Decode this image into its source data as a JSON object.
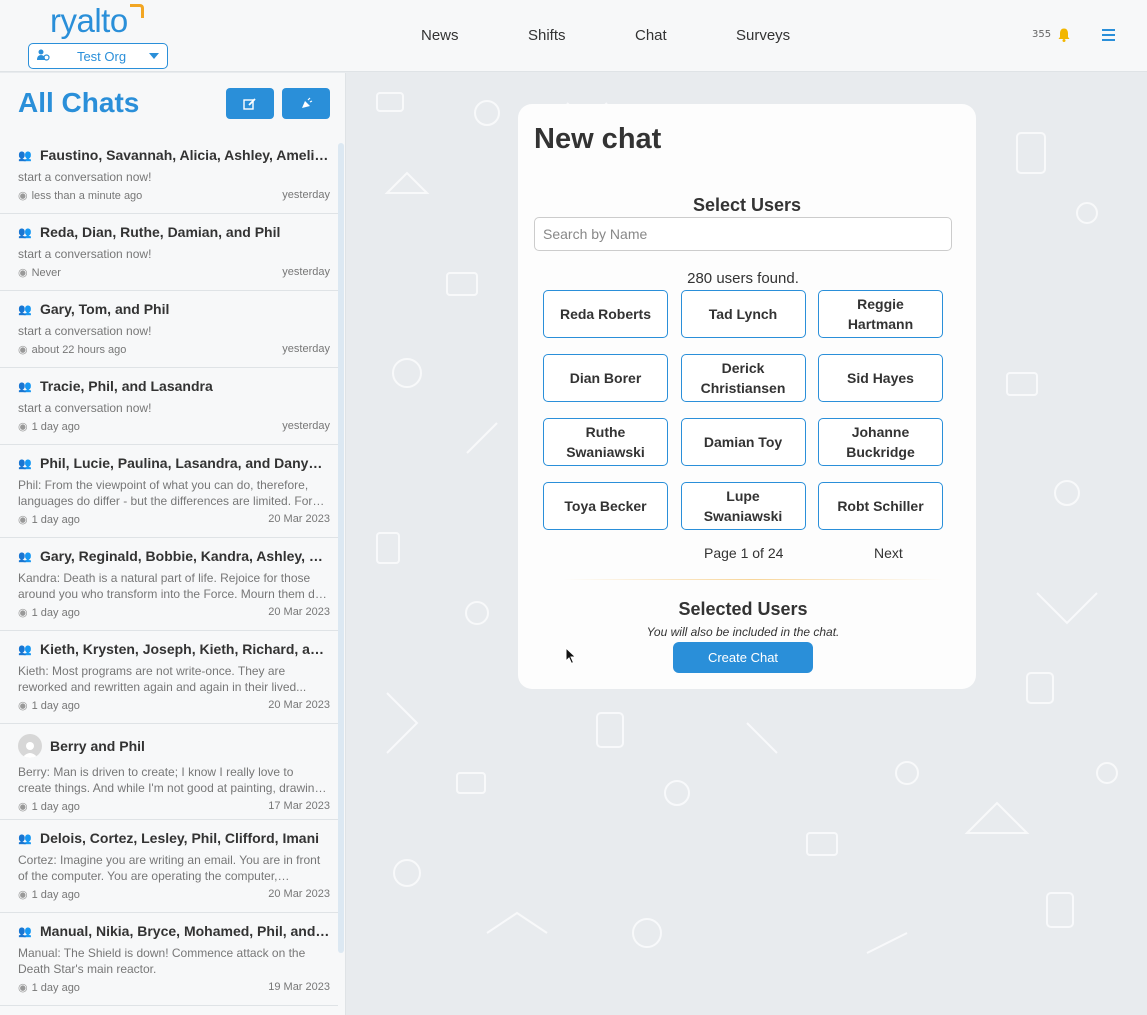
{
  "header": {
    "logo_text": "ryalto",
    "org_select": {
      "value": "Test Org",
      "icon": "org-user-icon"
    },
    "nav": [
      {
        "label": "News"
      },
      {
        "label": "Shifts"
      },
      {
        "label": "Chat"
      },
      {
        "label": "Surveys"
      }
    ],
    "notification_count": "355",
    "icons": [
      "bell-icon",
      "hamburger-menu-icon"
    ]
  },
  "sidebar": {
    "title": "All Chats",
    "buttons": [
      {
        "icon": "compose-icon"
      },
      {
        "icon": "broadcast-icon"
      }
    ],
    "chats": [
      {
        "name": "Faustino, Savannah, Alicia, Ashley, Amelia, and Phil",
        "preview": "start a conversation now!",
        "seen": "less than a minute ago",
        "date": "yesterday",
        "type": "group"
      },
      {
        "name": "Reda, Dian, Ruthe, Damian, and Phil",
        "preview": "start a conversation now!",
        "seen": "Never",
        "date": "yesterday",
        "type": "group"
      },
      {
        "name": "Gary, Tom, and Phil",
        "preview": "start a conversation now!",
        "seen": "about 22 hours ago",
        "date": "yesterday",
        "type": "group"
      },
      {
        "name": "Tracie, Phil, and Lasandra",
        "preview": "start a conversation now!",
        "seen": "1 day ago",
        "date": "yesterday",
        "type": "group"
      },
      {
        "name": "Phil, Lucie, Paulina, Lasandra, and Danyelle",
        "preview": "Phil: From the viewpoint of what you can do, therefore, languages do differ - but the differences are limited. For example...",
        "seen": "1 day ago",
        "date": "20 Mar 2023",
        "type": "group"
      },
      {
        "name": "Gary, Reginald, Bobbie, Kandra, Ashley, and Phil",
        "preview": "Kandra: Death is a natural part of life. Rejoice for those around you who transform into the Force. Mourn them do not...",
        "seen": "1 day ago",
        "date": "20 Mar 2023",
        "type": "group"
      },
      {
        "name": "Kieth, Krysten, Joseph, Kieth, Richard, and Phil",
        "preview": "Kieth: Most programs are not write-once. They are reworked and rewritten again and again in their lived...",
        "seen": "1 day ago",
        "date": "20 Mar 2023",
        "type": "group"
      },
      {
        "name": "Berry and Phil",
        "preview": "Berry: Man is driven to create; I know I really love to create things. And while I'm not good at painting, drawing, or...",
        "seen": "1 day ago",
        "date": "17 Mar 2023",
        "type": "direct"
      },
      {
        "name": "Delois, Cortez, Lesley, Phil, Clifford, Imani",
        "preview": "Cortez: Imagine you are writing an email. You are in front of the computer. You are operating the computer, clicking...",
        "seen": "1 day ago",
        "date": "20 Mar 2023",
        "type": "group"
      },
      {
        "name": "Manual, Nikia, Bryce, Mohamed, Phil, and Ann",
        "preview": "Manual: The Shield is down! Commence attack on the Death Star's main reactor.",
        "seen": "1 day ago",
        "date": "19 Mar 2023",
        "type": "group"
      }
    ]
  },
  "new_chat": {
    "title": "New chat",
    "select_users_heading": "Select Users",
    "search_placeholder": "Search by Name",
    "users_found": "280 users found.",
    "users": [
      "Reda Roberts",
      "Tad Lynch",
      "Reggie Hartmann",
      "Dian Borer",
      "Derick Christiansen",
      "Sid Hayes",
      "Ruthe Swaniawski",
      "Damian Toy",
      "Johanne Buckridge",
      "Toya Becker",
      "Lupe Swaniawski",
      "Robt Schiller"
    ],
    "page_info": "Page 1 of 24",
    "next_label": "Next",
    "selected_heading": "Selected Users",
    "selected_note": "You will also be included in the chat.",
    "create_label": "Create Chat"
  },
  "colors": {
    "accent": "#2a8fd9",
    "logo_accent": "#f2a623",
    "background": "#e8ebee"
  }
}
